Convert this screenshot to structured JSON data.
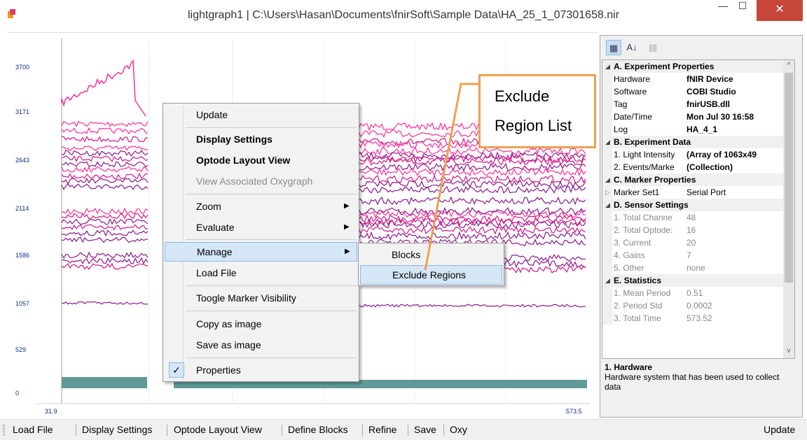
{
  "window": {
    "title": "lightgraph1 | C:\\Users\\Hasan\\Documents\\fnirSoft\\Sample Data\\HA_25_1_07301658.nir",
    "minimize_glyph": "—",
    "maximize_glyph": "☐",
    "close_glyph": "✕"
  },
  "chart": {
    "y_ticks": [
      "3700",
      "3171",
      "2643",
      "2114",
      "1586",
      "1057",
      "529",
      "0"
    ],
    "x_ticks": [
      "31.9",
      "573.5"
    ]
  },
  "context_menu": {
    "items": [
      {
        "label": "Update"
      },
      {
        "label": "Display Settings"
      },
      {
        "label": "Optode Layout View"
      },
      {
        "label": "View Associated Oxygraph"
      },
      {
        "label": "Zoom"
      },
      {
        "label": "Evaluate"
      },
      {
        "label": "Manage"
      },
      {
        "label": "Load File"
      },
      {
        "label": "Toogle Marker Visibility"
      },
      {
        "label": "Copy as image"
      },
      {
        "label": "Save as image"
      },
      {
        "label": "Properties"
      }
    ],
    "check_glyph": "✓",
    "arrow_glyph": "▶"
  },
  "submenu": {
    "items": [
      {
        "label": "Blocks"
      },
      {
        "label": "Exclude Regions"
      }
    ]
  },
  "callout": {
    "line1": "Exclude",
    "line2": "Region List",
    "color": "#f0a050"
  },
  "properties": {
    "toolbar": {
      "categorized": "▦",
      "alphabetical": "A↓",
      "pages": "▤"
    },
    "rows": [
      {
        "kind": "cat",
        "label": "A. Experiment Properties"
      },
      {
        "kind": "prop",
        "name": "Hardware",
        "value": "fNIR Device"
      },
      {
        "kind": "prop",
        "name": "Software",
        "value": "COBI Studio"
      },
      {
        "kind": "prop",
        "name": "Tag",
        "value": "fnirUSB.dll"
      },
      {
        "kind": "prop",
        "name": "Date/Time",
        "value": "Mon Jul 30 16:58"
      },
      {
        "kind": "prop",
        "name": "Log",
        "value": "HA_4_1"
      },
      {
        "kind": "cat",
        "label": "B. Experiment Data"
      },
      {
        "kind": "prop",
        "name": "1. Light Intensity",
        "value": "(Array of 1063x49"
      },
      {
        "kind": "prop",
        "name": "2. Events/Marke",
        "value": "(Collection)"
      },
      {
        "kind": "cat",
        "label": "C. Marker Properties"
      },
      {
        "kind": "prop",
        "name": "Marker Set1",
        "value": "Serial Port"
      },
      {
        "kind": "cat",
        "label": "D. Sensor Settings"
      },
      {
        "kind": "prop",
        "name": "1. Total Channe",
        "value": "48"
      },
      {
        "kind": "prop",
        "name": "2. Total Optode:",
        "value": "16"
      },
      {
        "kind": "prop",
        "name": "3. Current",
        "value": "20"
      },
      {
        "kind": "prop",
        "name": "4. Gains",
        "value": "7"
      },
      {
        "kind": "prop",
        "name": "5. Other",
        "value": "none"
      },
      {
        "kind": "cat",
        "label": "E. Statistics"
      },
      {
        "kind": "prop",
        "name": "1. Mean Period",
        "value": "0.51"
      },
      {
        "kind": "prop",
        "name": "2. Period Std",
        "value": "0.0002"
      },
      {
        "kind": "prop",
        "name": "3. Total Time",
        "value": "573.52"
      }
    ],
    "description": {
      "title": "1. Hardware",
      "text": "Hardware system that has been used to collect data"
    }
  },
  "statusbar": {
    "items": [
      "Load File",
      "Display Settings",
      "Optode Layout View",
      "Define Blocks",
      "Refine",
      "Save",
      "Oxy"
    ],
    "right": "Update"
  },
  "colors": {
    "pink": "#ff2f9a",
    "magenta": "#d21a8a",
    "purple": "#8a1a8e",
    "teal": "#5f9a96",
    "axis_text": "#0b2a8a",
    "menu_highlight": "#d5e6f7"
  }
}
